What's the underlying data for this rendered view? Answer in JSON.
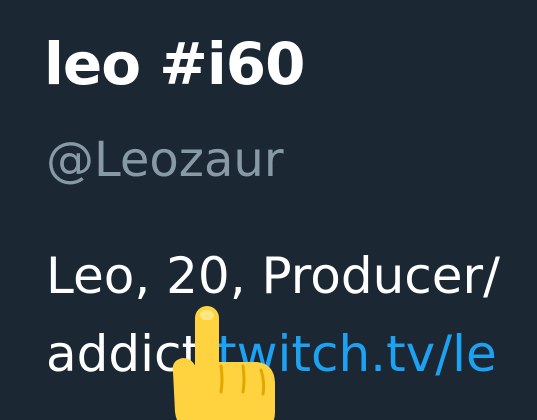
{
  "profile": {
    "display_name": "leo #i60",
    "handle": "@Leozaur",
    "bio_line1": "Leo, 20, Producer/",
    "bio_line2_text": "addict ",
    "bio_link": "twitch.tv/le"
  },
  "colors": {
    "background": "#1b2733",
    "name": "#ffffff",
    "handle": "#8899a6",
    "link": "#1da1f2",
    "pointer": "#ffd23f"
  },
  "icons": {
    "pointer": "pointing-hand-icon"
  }
}
